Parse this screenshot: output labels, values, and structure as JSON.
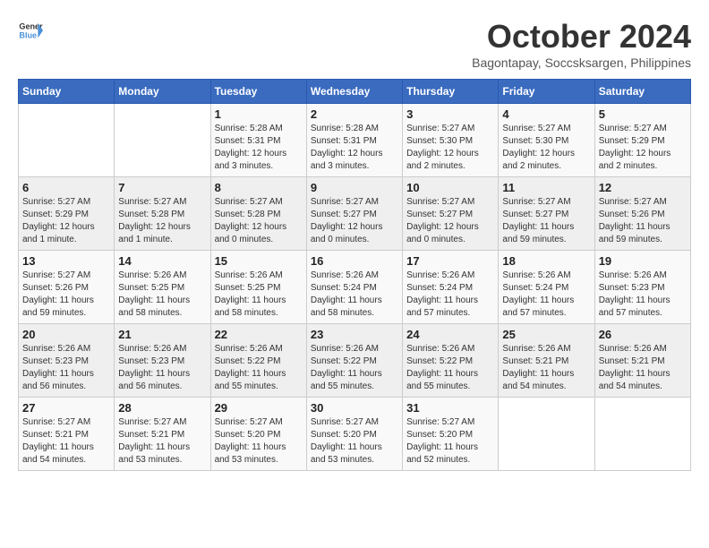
{
  "logo": {
    "line1": "General",
    "line2": "Blue"
  },
  "title": "October 2024",
  "subtitle": "Bagontapay, Soccsksargen, Philippines",
  "days_header": [
    "Sunday",
    "Monday",
    "Tuesday",
    "Wednesday",
    "Thursday",
    "Friday",
    "Saturday"
  ],
  "weeks": [
    [
      {
        "day": "",
        "info": ""
      },
      {
        "day": "",
        "info": ""
      },
      {
        "day": "1",
        "info": "Sunrise: 5:28 AM\nSunset: 5:31 PM\nDaylight: 12 hours\nand 3 minutes."
      },
      {
        "day": "2",
        "info": "Sunrise: 5:28 AM\nSunset: 5:31 PM\nDaylight: 12 hours\nand 3 minutes."
      },
      {
        "day": "3",
        "info": "Sunrise: 5:27 AM\nSunset: 5:30 PM\nDaylight: 12 hours\nand 2 minutes."
      },
      {
        "day": "4",
        "info": "Sunrise: 5:27 AM\nSunset: 5:30 PM\nDaylight: 12 hours\nand 2 minutes."
      },
      {
        "day": "5",
        "info": "Sunrise: 5:27 AM\nSunset: 5:29 PM\nDaylight: 12 hours\nand 2 minutes."
      }
    ],
    [
      {
        "day": "6",
        "info": "Sunrise: 5:27 AM\nSunset: 5:29 PM\nDaylight: 12 hours\nand 1 minute."
      },
      {
        "day": "7",
        "info": "Sunrise: 5:27 AM\nSunset: 5:28 PM\nDaylight: 12 hours\nand 1 minute."
      },
      {
        "day": "8",
        "info": "Sunrise: 5:27 AM\nSunset: 5:28 PM\nDaylight: 12 hours\nand 0 minutes."
      },
      {
        "day": "9",
        "info": "Sunrise: 5:27 AM\nSunset: 5:27 PM\nDaylight: 12 hours\nand 0 minutes."
      },
      {
        "day": "10",
        "info": "Sunrise: 5:27 AM\nSunset: 5:27 PM\nDaylight: 12 hours\nand 0 minutes."
      },
      {
        "day": "11",
        "info": "Sunrise: 5:27 AM\nSunset: 5:27 PM\nDaylight: 11 hours\nand 59 minutes."
      },
      {
        "day": "12",
        "info": "Sunrise: 5:27 AM\nSunset: 5:26 PM\nDaylight: 11 hours\nand 59 minutes."
      }
    ],
    [
      {
        "day": "13",
        "info": "Sunrise: 5:27 AM\nSunset: 5:26 PM\nDaylight: 11 hours\nand 59 minutes."
      },
      {
        "day": "14",
        "info": "Sunrise: 5:26 AM\nSunset: 5:25 PM\nDaylight: 11 hours\nand 58 minutes."
      },
      {
        "day": "15",
        "info": "Sunrise: 5:26 AM\nSunset: 5:25 PM\nDaylight: 11 hours\nand 58 minutes."
      },
      {
        "day": "16",
        "info": "Sunrise: 5:26 AM\nSunset: 5:24 PM\nDaylight: 11 hours\nand 58 minutes."
      },
      {
        "day": "17",
        "info": "Sunrise: 5:26 AM\nSunset: 5:24 PM\nDaylight: 11 hours\nand 57 minutes."
      },
      {
        "day": "18",
        "info": "Sunrise: 5:26 AM\nSunset: 5:24 PM\nDaylight: 11 hours\nand 57 minutes."
      },
      {
        "day": "19",
        "info": "Sunrise: 5:26 AM\nSunset: 5:23 PM\nDaylight: 11 hours\nand 57 minutes."
      }
    ],
    [
      {
        "day": "20",
        "info": "Sunrise: 5:26 AM\nSunset: 5:23 PM\nDaylight: 11 hours\nand 56 minutes."
      },
      {
        "day": "21",
        "info": "Sunrise: 5:26 AM\nSunset: 5:23 PM\nDaylight: 11 hours\nand 56 minutes."
      },
      {
        "day": "22",
        "info": "Sunrise: 5:26 AM\nSunset: 5:22 PM\nDaylight: 11 hours\nand 55 minutes."
      },
      {
        "day": "23",
        "info": "Sunrise: 5:26 AM\nSunset: 5:22 PM\nDaylight: 11 hours\nand 55 minutes."
      },
      {
        "day": "24",
        "info": "Sunrise: 5:26 AM\nSunset: 5:22 PM\nDaylight: 11 hours\nand 55 minutes."
      },
      {
        "day": "25",
        "info": "Sunrise: 5:26 AM\nSunset: 5:21 PM\nDaylight: 11 hours\nand 54 minutes."
      },
      {
        "day": "26",
        "info": "Sunrise: 5:26 AM\nSunset: 5:21 PM\nDaylight: 11 hours\nand 54 minutes."
      }
    ],
    [
      {
        "day": "27",
        "info": "Sunrise: 5:27 AM\nSunset: 5:21 PM\nDaylight: 11 hours\nand 54 minutes."
      },
      {
        "day": "28",
        "info": "Sunrise: 5:27 AM\nSunset: 5:21 PM\nDaylight: 11 hours\nand 53 minutes."
      },
      {
        "day": "29",
        "info": "Sunrise: 5:27 AM\nSunset: 5:20 PM\nDaylight: 11 hours\nand 53 minutes."
      },
      {
        "day": "30",
        "info": "Sunrise: 5:27 AM\nSunset: 5:20 PM\nDaylight: 11 hours\nand 53 minutes."
      },
      {
        "day": "31",
        "info": "Sunrise: 5:27 AM\nSunset: 5:20 PM\nDaylight: 11 hours\nand 52 minutes."
      },
      {
        "day": "",
        "info": ""
      },
      {
        "day": "",
        "info": ""
      }
    ]
  ]
}
